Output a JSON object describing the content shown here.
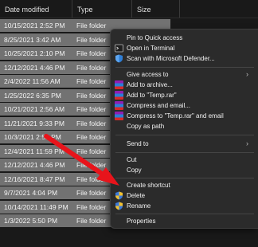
{
  "header": {
    "columns": [
      "Date modified",
      "Type",
      "Size"
    ]
  },
  "rows": [
    {
      "date": "10/15/2021 2:52 PM",
      "type": "File folder"
    },
    {
      "date": "8/25/2021 3:42 AM",
      "type": "File folder"
    },
    {
      "date": "10/25/2021 2:10 PM",
      "type": "File folder"
    },
    {
      "date": "12/12/2021 4:46 PM",
      "type": "File folder"
    },
    {
      "date": "2/4/2022 11:56 AM",
      "type": "File folder"
    },
    {
      "date": "1/25/2022 6:35 PM",
      "type": "File folder"
    },
    {
      "date": "10/21/2021 2:56 AM",
      "type": "File folder"
    },
    {
      "date": "11/21/2021 9:33 PM",
      "type": "File folder"
    },
    {
      "date": "10/3/2021 2:52 PM",
      "type": "File folder"
    },
    {
      "date": "12/4/2021 11:59 PM",
      "type": "File folder"
    },
    {
      "date": "12/12/2021 4:46 PM",
      "type": "File folder"
    },
    {
      "date": "12/16/2021 8:47 PM",
      "type": "File folder"
    },
    {
      "date": "9/7/2021 4:04 PM",
      "type": "File folder"
    },
    {
      "date": "10/14/2021 11:49 PM",
      "type": "File folder"
    },
    {
      "date": "1/3/2022 5:50 PM",
      "type": "File folder"
    }
  ],
  "context_menu": {
    "pin_quick_access": "Pin to Quick access",
    "open_terminal": "Open in Terminal",
    "scan_defender": "Scan with Microsoft Defender...",
    "give_access": "Give access to",
    "add_archive": "Add to archive...",
    "add_temp_rar": "Add to \"Temp.rar\"",
    "compress_email": "Compress and email...",
    "compress_temp_email": "Compress to \"Temp.rar\" and email",
    "copy_path": "Copy as path",
    "send_to": "Send to",
    "cut": "Cut",
    "copy": "Copy",
    "create_shortcut": "Create shortcut",
    "delete": "Delete",
    "rename": "Rename",
    "properties": "Properties",
    "submenu_arrow": "›"
  },
  "colors": {
    "row_selected": "#727272",
    "menu_bg": "#2b2b2b",
    "arrow": "#e8141b"
  },
  "icons": [
    "terminal-icon",
    "defender-shield-icon",
    "winrar-icon",
    "uac-shield-icon",
    "red-arrow-annotation"
  ]
}
